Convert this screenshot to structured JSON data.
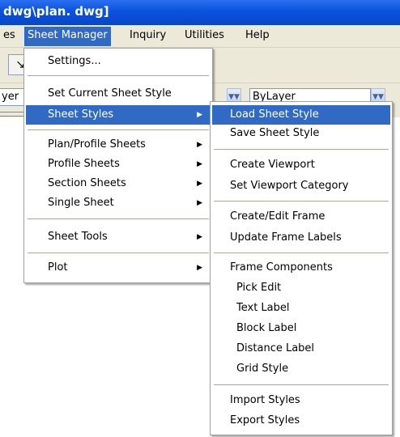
{
  "window": {
    "title": "dwg\\plan. dwg]"
  },
  "menubar": {
    "items": [
      {
        "label": "es"
      },
      {
        "label": "Sheet Manager"
      },
      {
        "label": "Inquiry"
      },
      {
        "label": "Utilities"
      },
      {
        "label": "Help"
      }
    ]
  },
  "toolbar": {
    "layer_combo_value": "yer",
    "linetype_combo_value": "ByLayer",
    "tool_icon": "pointer-arrow-icon"
  },
  "sheet_manager_menu": {
    "items": [
      {
        "label": "Settings..."
      },
      {
        "label": "Set Current Sheet Style"
      },
      {
        "label": "Sheet Styles"
      },
      {
        "label": "Plan/Profile Sheets"
      },
      {
        "label": "Profile Sheets"
      },
      {
        "label": "Section Sheets"
      },
      {
        "label": "Single Sheet"
      },
      {
        "label": "Sheet Tools"
      },
      {
        "label": "Plot"
      }
    ]
  },
  "sheet_styles_submenu": {
    "items": [
      {
        "label": "Load Sheet Style"
      },
      {
        "label": "Save Sheet Style"
      },
      {
        "label": "Create Viewport"
      },
      {
        "label": "Set Viewport Category"
      },
      {
        "label": "Create/Edit Frame"
      },
      {
        "label": "Update Frame Labels"
      },
      {
        "label": "Frame Components"
      },
      {
        "label": "Pick Edit"
      },
      {
        "label": "Text Label"
      },
      {
        "label": "Block Label"
      },
      {
        "label": "Distance Label"
      },
      {
        "label": "Grid Style"
      },
      {
        "label": "Import Styles"
      },
      {
        "label": "Export Styles"
      }
    ]
  },
  "colors": {
    "titlebar": "#0a52de",
    "highlight": "#316ac5",
    "menu_bg": "#ece9d8"
  }
}
